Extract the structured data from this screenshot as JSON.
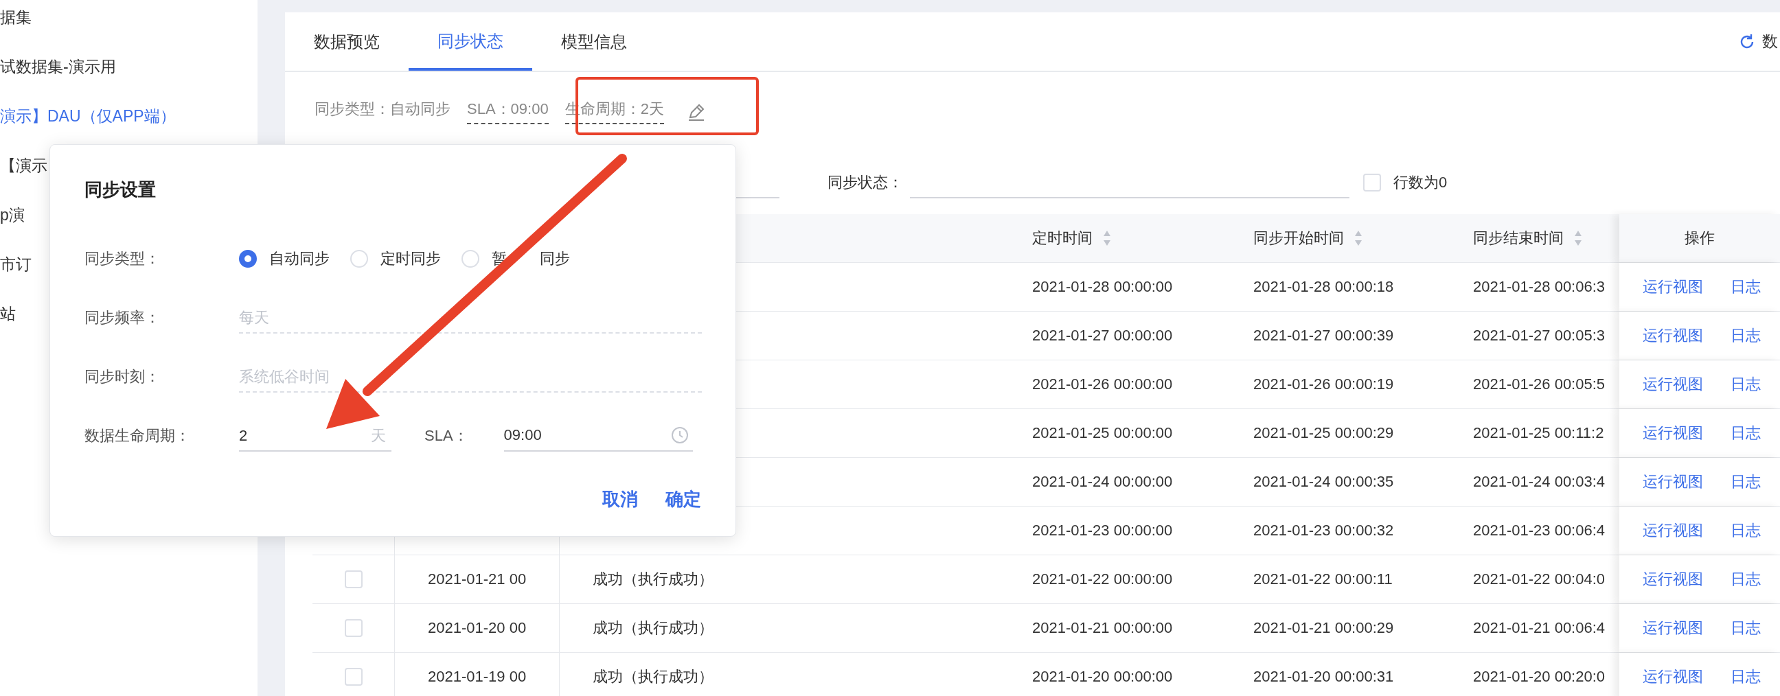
{
  "sidebar": {
    "items": [
      {
        "label": "据集",
        "selected": false
      },
      {
        "label": "试数据集-演示用",
        "selected": false
      },
      {
        "label": "演示】DAU（仅APP端）",
        "selected": true
      },
      {
        "label": "【演示",
        "selected": false
      },
      {
        "label": "p演",
        "selected": false
      },
      {
        "label": "市订",
        "selected": false
      },
      {
        "label": "站",
        "selected": false
      }
    ]
  },
  "tabs": [
    {
      "label": "数据预览",
      "selected": false
    },
    {
      "label": "同步状态",
      "selected": true
    },
    {
      "label": "模型信息",
      "selected": false
    }
  ],
  "refresh_button": {
    "label": "数"
  },
  "sync_info": [
    {
      "label": "同步类型：自动同步",
      "dashed": false
    },
    {
      "label": "SLA：09:00",
      "dashed": true
    },
    {
      "label": "生命周期：2天",
      "dashed": true
    }
  ],
  "filters": {
    "status_label": "同步状态：",
    "rows_zero": {
      "label": "行数为0",
      "checked": false
    }
  },
  "table": {
    "columns": [
      {
        "label": "定时时间",
        "sortable": true
      },
      {
        "label": "同步开始时间",
        "sortable": true
      },
      {
        "label": "同步结束时间",
        "sortable": true
      },
      {
        "label": "操作",
        "sortable": false
      }
    ],
    "rows": [
      {
        "scheduled": "2021-01-28 00:00:00",
        "start": "2021-01-28 00:00:18",
        "end": "2021-01-28 00:06:3",
        "actions": [
          "运行视图",
          "日志"
        ]
      },
      {
        "scheduled": "2021-01-27 00:00:00",
        "start": "2021-01-27 00:00:39",
        "end": "2021-01-27 00:05:3",
        "actions": [
          "运行视图",
          "日志"
        ]
      },
      {
        "scheduled": "2021-01-26 00:00:00",
        "start": "2021-01-26 00:00:19",
        "end": "2021-01-26 00:05:5",
        "actions": [
          "运行视图",
          "日志"
        ]
      },
      {
        "scheduled": "2021-01-25 00:00:00",
        "start": "2021-01-25 00:00:29",
        "end": "2021-01-25 00:11:2",
        "actions": [
          "运行视图",
          "日志"
        ]
      },
      {
        "scheduled": "2021-01-24 00:00:00",
        "start": "2021-01-24 00:00:35",
        "end": "2021-01-24 00:03:4",
        "actions": [
          "运行视图",
          "日志"
        ]
      },
      {
        "scheduled": "2021-01-23 00:00:00",
        "start": "2021-01-23 00:00:32",
        "end": "2021-01-23 00:06:4",
        "actions": [
          "运行视图",
          "日志"
        ]
      },
      {
        "checked": false,
        "date": "2021-01-21 00",
        "status": "成功（执行成功）",
        "scheduled": "2021-01-22 00:00:00",
        "start": "2021-01-22 00:00:11",
        "end": "2021-01-22 00:04:0",
        "actions": [
          "运行视图",
          "日志"
        ]
      },
      {
        "checked": false,
        "date": "2021-01-20 00",
        "status": "成功（执行成功）",
        "scheduled": "2021-01-21 00:00:00",
        "start": "2021-01-21 00:00:29",
        "end": "2021-01-21 00:06:4",
        "actions": [
          "运行视图",
          "日志"
        ]
      },
      {
        "checked": false,
        "date": "2021-01-19 00",
        "status": "成功（执行成功）",
        "scheduled": "2021-01-20 00:00:00",
        "start": "2021-01-20 00:00:31",
        "end": "2021-01-20 00:20:0",
        "actions": [
          "运行视图",
          "日志"
        ]
      }
    ]
  },
  "dialog": {
    "title": "同步设置",
    "rows": [
      {
        "kind": "radio",
        "label": "同步类型：",
        "options": [
          {
            "label": "自动同步",
            "selected": true
          },
          {
            "label": "定时同步",
            "selected": false
          },
          {
            "label": "暂",
            "label_after_mark": "同步",
            "selected": false
          }
        ]
      },
      {
        "kind": "select",
        "label": "同步频率：",
        "placeholder": "每天",
        "disabled": true
      },
      {
        "kind": "select",
        "label": "同步时刻：",
        "placeholder": "系统低谷时间",
        "disabled": true
      },
      {
        "kind": "lifecycle",
        "label": "数据生命周期：",
        "value": "2",
        "suffix": "天",
        "sla_label": "SLA：",
        "sla_value": "09:00"
      }
    ],
    "buttons": [
      "取消",
      "确定"
    ]
  }
}
